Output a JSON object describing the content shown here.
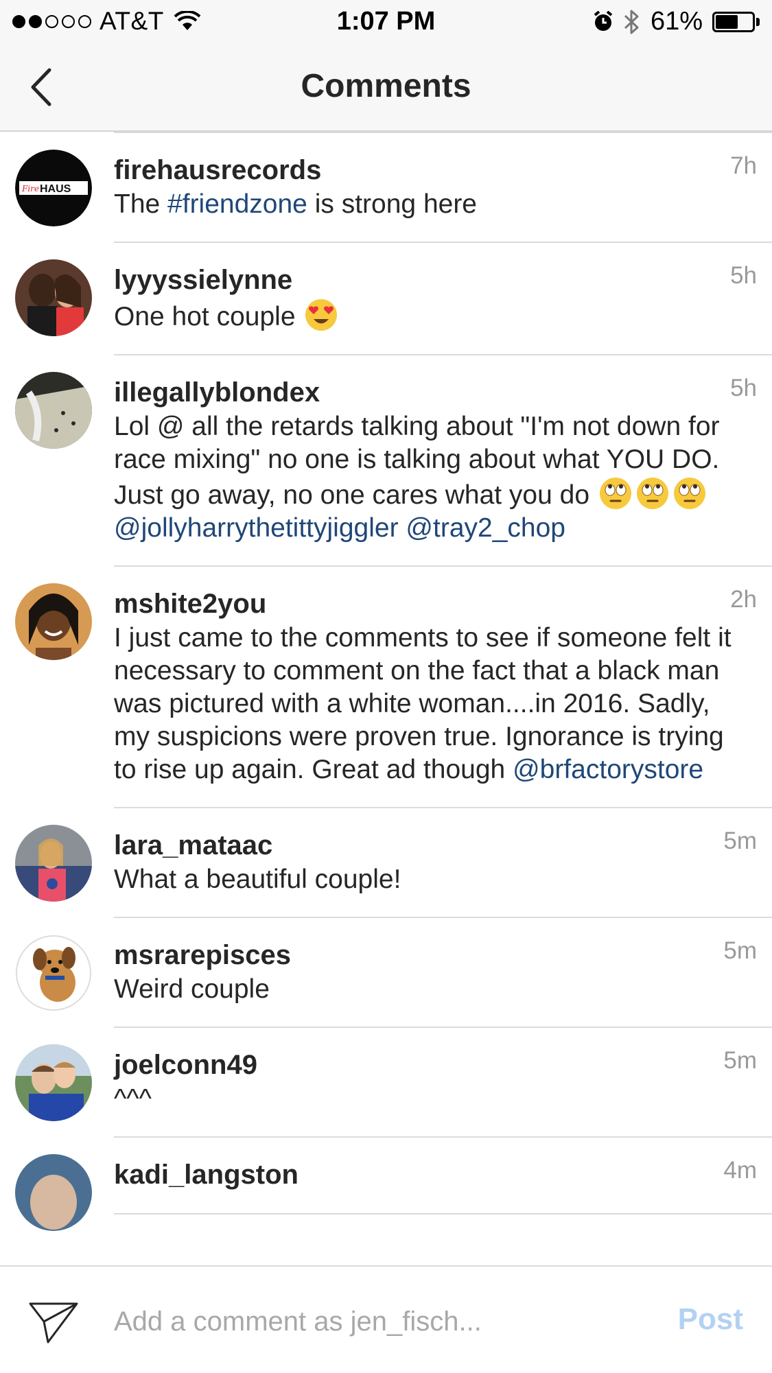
{
  "status_bar": {
    "carrier": "AT&T",
    "time": "1:07 PM",
    "battery": "61%",
    "battery_level": 0.61,
    "signal_bars_filled": 2
  },
  "nav": {
    "title": "Comments"
  },
  "comments": [
    {
      "username": "firehausrecords",
      "time": "7h",
      "parts": [
        {
          "text": "The "
        },
        {
          "text": "#friendzone",
          "link": true
        },
        {
          "text": " is strong here"
        }
      ]
    },
    {
      "username": "lyyyssielynne",
      "time": "5h",
      "parts": [
        {
          "text": "One hot couple "
        },
        {
          "emoji": "heart-eyes-emoji"
        }
      ]
    },
    {
      "username": "illegallyblondex",
      "time": "5h",
      "parts": [
        {
          "text": "Lol @ all the retards talking about \"I'm not down for race mixing\" no one is talking about what YOU DO. Just go away, no one cares what you do "
        },
        {
          "emoji": "eye-roll-emoji"
        },
        {
          "emoji": "eye-roll-emoji"
        },
        {
          "emoji": "eye-roll-emoji"
        },
        {
          "text": " "
        },
        {
          "text": "@jollyharrythetittyjiggler",
          "link": true
        },
        {
          "text": " "
        },
        {
          "text": "@tray2_chop",
          "link": true
        }
      ]
    },
    {
      "username": "mshite2you",
      "time": "2h",
      "parts": [
        {
          "text": "I just came to the comments to see if someone felt it necessary to comment on the fact that a black man was pictured with a white woman....in 2016. Sadly, my suspicions were proven true. Ignorance is trying to rise up again. Great ad though "
        },
        {
          "text": "@brfactorystore",
          "link": true
        }
      ]
    },
    {
      "username": "lara_mataac",
      "time": "5m",
      "parts": [
        {
          "text": "What a beautiful couple!"
        }
      ]
    },
    {
      "username": "msrarepisces",
      "time": "5m",
      "parts": [
        {
          "text": "Weird couple"
        }
      ]
    },
    {
      "username": "joelconn49",
      "time": "5m",
      "parts": [
        {
          "text": "^^^"
        }
      ]
    },
    {
      "username": "kadi_langston",
      "time": "4m",
      "parts": [
        {
          "text": ""
        }
      ]
    }
  ],
  "footer": {
    "placeholder": "Add a comment as jen_fisch...",
    "post_label": "Post"
  },
  "colors": {
    "link": "#1f4778",
    "post_disabled": "#b3d1f2",
    "timestamp": "#999999"
  }
}
